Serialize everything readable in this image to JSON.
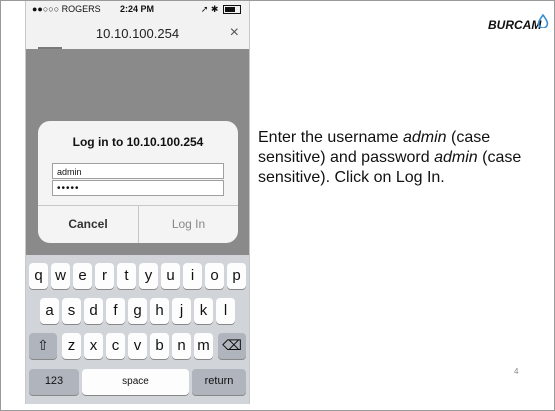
{
  "statusbar": {
    "carrier": "●●○○○ ROGERS",
    "time": "2:24 PM",
    "right": "➚ ✱"
  },
  "browser": {
    "url": "10.10.100.254",
    "close": "×"
  },
  "dialog": {
    "title": "Log in to 10.10.100.254",
    "username_value": "admin",
    "password_value": "•••••",
    "cancel_label": "Cancel",
    "login_label": "Log In"
  },
  "keyboard": {
    "row1": [
      "q",
      "w",
      "e",
      "r",
      "t",
      "y",
      "u",
      "i",
      "o",
      "p"
    ],
    "row2": [
      "a",
      "s",
      "d",
      "f",
      "g",
      "h",
      "j",
      "k",
      "l"
    ],
    "row3": [
      "z",
      "x",
      "c",
      "v",
      "b",
      "n",
      "m"
    ],
    "shift": "⇧",
    "backspace": "⌫",
    "numbers": "123",
    "space": "space",
    "return": "return"
  },
  "logo": {
    "text": "BURCAM",
    "accent": "#3a8fd4"
  },
  "instruction": {
    "p1": "Enter the username ",
    "u": "admin",
    "p2": " (case sensitive) and password ",
    "pw": "admin",
    "p3": " (case sensitive). Click on Log In."
  },
  "page_number": "4"
}
